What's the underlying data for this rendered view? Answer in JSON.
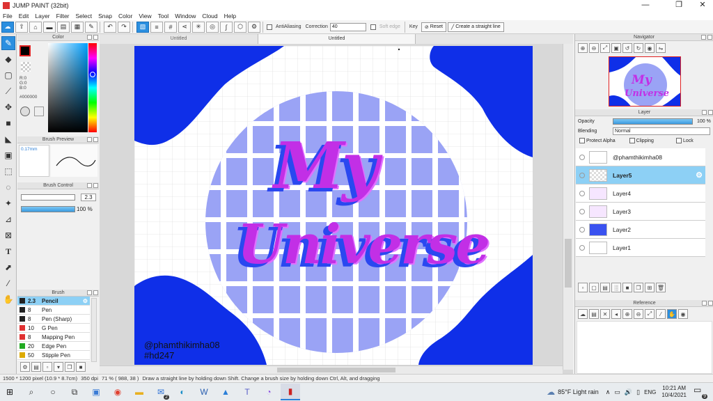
{
  "window": {
    "title": "JUMP PAINT (32bit)"
  },
  "menu": [
    "File",
    "Edit",
    "Layer",
    "Filter",
    "Select",
    "Snap",
    "Color",
    "View",
    "Tool",
    "Window",
    "Cloud",
    "Help"
  ],
  "toolbar": {
    "antialiasing_label": "AntiAliasing",
    "correction_label": "Correction",
    "correction_value": "40",
    "soft_edge_label": "Soft edge",
    "key_label": "Key",
    "reset_label": "Reset",
    "straight_line_label": "Create a straight line"
  },
  "color_panel": {
    "title": "Color",
    "r": "R:0",
    "g": "G:0",
    "b": "B:0",
    "hex": "#000000",
    "fg_color": "#000000"
  },
  "brush_preview": {
    "title": "Brush Preview",
    "size": "0.17mm"
  },
  "brush_control": {
    "title": "Brush Control",
    "size_value": "2.3",
    "opacity_value": "100 %",
    "opacity_fraction": 1.0
  },
  "brush_list": {
    "title": "Brush",
    "items": [
      {
        "size": "2.3",
        "name": "Pencil",
        "color": "#222222",
        "selected": true
      },
      {
        "size": "8",
        "name": "Pen",
        "color": "#222222"
      },
      {
        "size": "8",
        "name": "Pen (Sharp)",
        "color": "#222222"
      },
      {
        "size": "10",
        "name": "G Pen",
        "color": "#e03030"
      },
      {
        "size": "8",
        "name": "Mapping Pen",
        "color": "#e03030"
      },
      {
        "size": "20",
        "name": "Edge Pen",
        "color": "#22aa22"
      },
      {
        "size": "50",
        "name": "Stipple Pen",
        "color": "#ddaa00"
      }
    ]
  },
  "canvas_tabs": [
    "Untitled",
    "Untitled"
  ],
  "artwork": {
    "title_line1": "My",
    "title_line2": "Universe",
    "credit1": "@phamthikimha08",
    "credit2": "#hd247",
    "blue": "#0f2fe8",
    "circle": "#9aa3f5",
    "text_pink": "#d63cf0"
  },
  "navigator": {
    "title": "Navigator"
  },
  "layer_panel": {
    "title": "Layer",
    "opacity_label": "Opacity",
    "opacity_value": "100 %",
    "blending_label": "Blending",
    "blending_value": "Normal",
    "protect_alpha": "Protect Alpha",
    "clipping": "Clipping",
    "lock": "Lock",
    "layers": [
      {
        "name": "@phamthikimha08"
      },
      {
        "name": "Layer5",
        "selected": true
      },
      {
        "name": "Layer4"
      },
      {
        "name": "Layer3"
      },
      {
        "name": "Layer2"
      },
      {
        "name": "Layer1"
      }
    ]
  },
  "reference": {
    "title": "Reference"
  },
  "status": {
    "size": "1500 * 1200 pixel",
    "cm": "(10.9 * 8.7cm)",
    "dpi": "350 dpi",
    "zoom": "71 %",
    "coords": "( 988, 38 )",
    "hint": "Draw a straight line by holding down Shift. Change a brush size by holding down Ctrl, Alt, and dragging"
  },
  "taskbar": {
    "weather": "85°F  Light rain",
    "lang": "ENG",
    "time": "10:21 AM",
    "date": "10/4/2021",
    "notif": "9",
    "mail_badge": "2"
  }
}
